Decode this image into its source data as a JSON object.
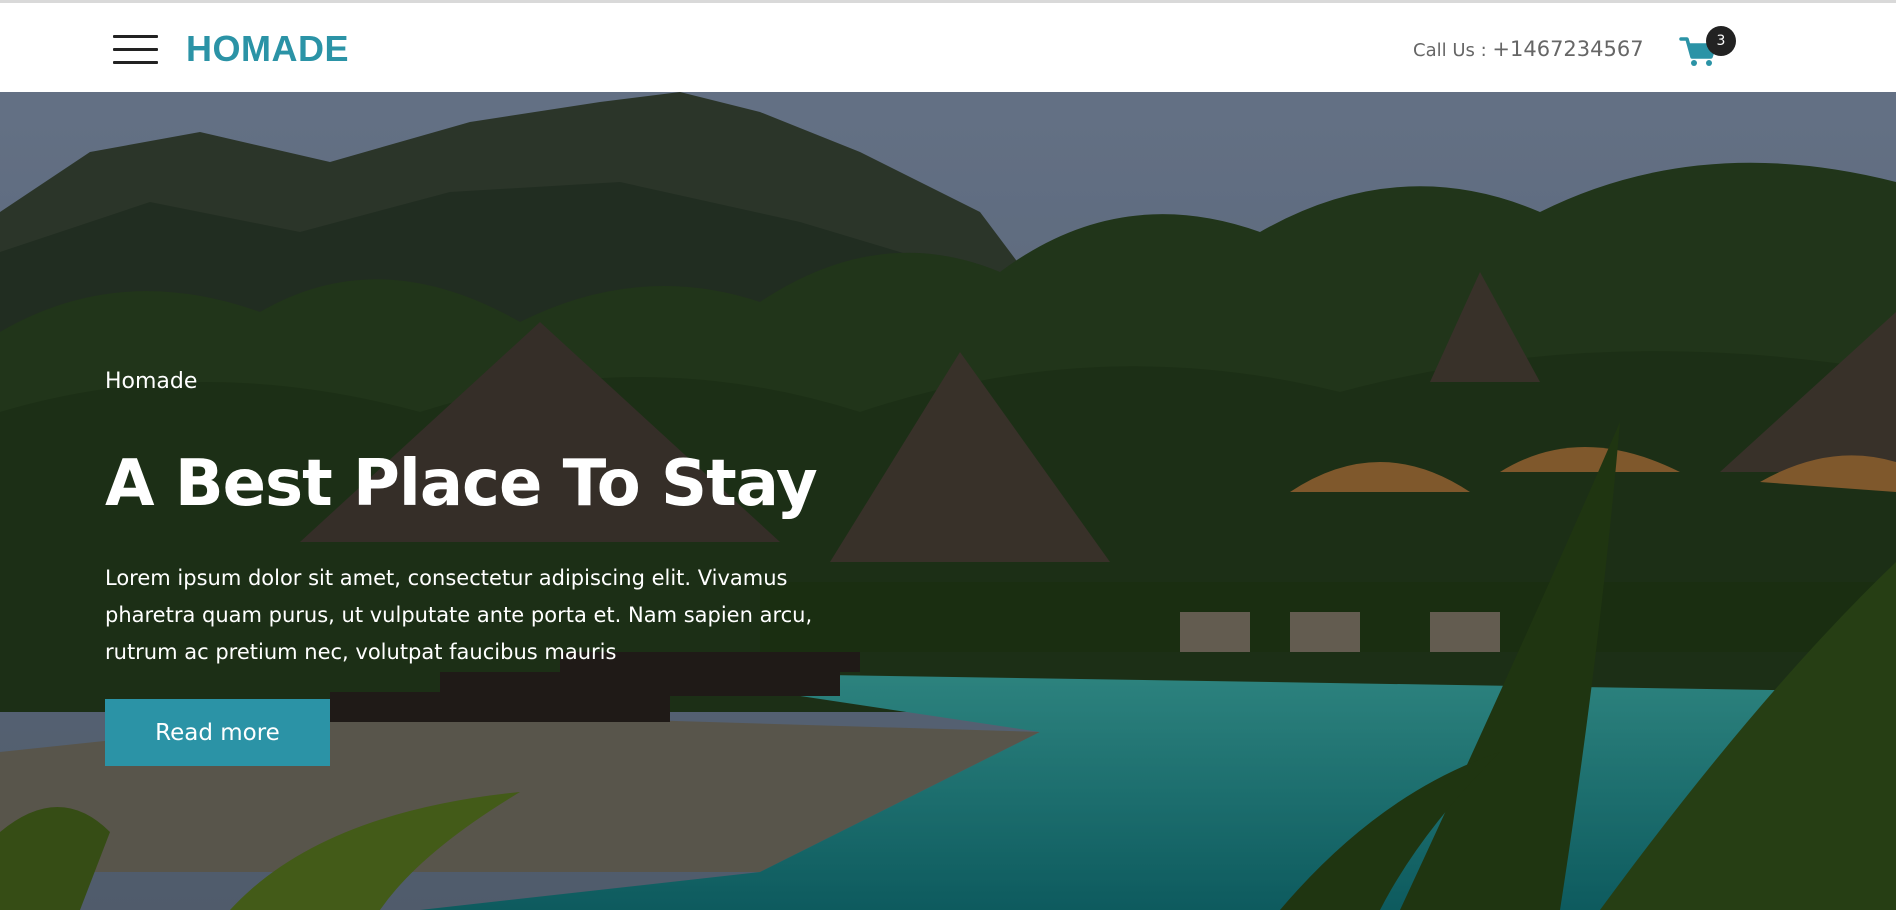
{
  "header": {
    "logo": "HOMADE",
    "call_label": "Call Us : ",
    "phone": "+1467234567",
    "cart_count": "3",
    "menu_icon": "hamburger-menu-icon",
    "cart_icon": "shopping-cart-icon"
  },
  "hero": {
    "eyebrow": "Homade",
    "title": "A Best Place To Stay",
    "description": "Lorem ipsum dolor sit amet, consectetur adipiscing elit. Vivamus pharetra quam purus, ut vulputate ante porta et. Nam sapien arcu, rutrum ac pretium nec, volutpat faucibus mauris",
    "button_label": "Read more"
  },
  "colors": {
    "accent": "#2b93a6",
    "badge": "#222222"
  }
}
